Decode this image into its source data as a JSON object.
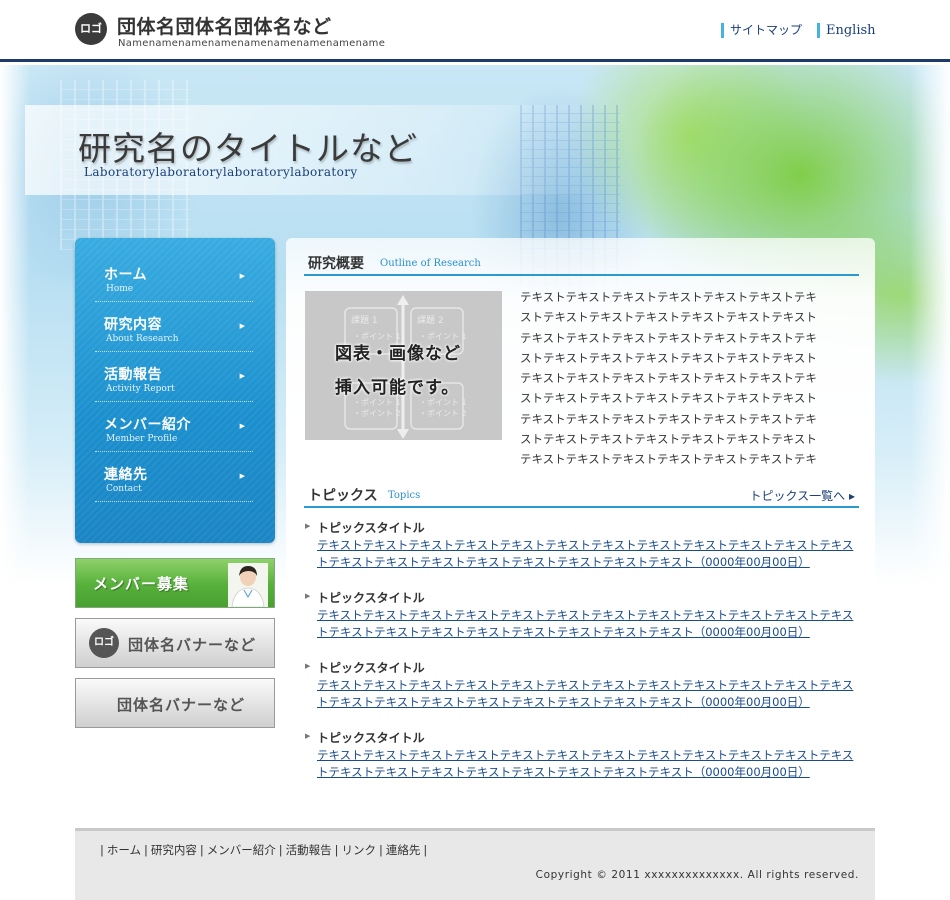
{
  "header": {
    "logo_text": "ロゴ",
    "org_name": "団体名団体名団体名など",
    "org_sub": "Namenamenamenamenamenamenamenamename",
    "links": [
      {
        "label": "サイトマップ"
      },
      {
        "label": "English"
      }
    ]
  },
  "hero": {
    "title": "研究名のタイトルなど",
    "subtitle": "Laboratorylaboratorylaboratorylaboratory"
  },
  "nav": {
    "items": [
      {
        "jp": "ホーム",
        "en": "Home"
      },
      {
        "jp": "研究内容",
        "en": "About Research"
      },
      {
        "jp": "活動報告",
        "en": "Activity Report"
      },
      {
        "jp": "メンバー紹介",
        "en": "Member Profile"
      },
      {
        "jp": "連絡先",
        "en": "Contact"
      }
    ],
    "arrow": "▶"
  },
  "banners": {
    "recruit": "メンバー募集",
    "org_logo": "ロゴ",
    "org_banner1": "団体名バナーなど",
    "org_banner2": "団体名バナーなど"
  },
  "research": {
    "heading_jp": "研究概要",
    "heading_en": "Outline of Research",
    "image": {
      "line1": "図表・画像など",
      "line2": "挿入可能です。",
      "box1_title": "課題 1",
      "box2_title": "課題 2",
      "point1": "・ポイント 1",
      "point2": "・ポイント 2"
    },
    "text": "テキストテキストテキストテキストテキストテキストテキストテキストテキストテキストテキストテキストテキストテキストテキストテキストテキストテキストテキストテキストテキストテキストテキストテキストテキストテキストテキストテキストテキストテキストテキストテキストテキストテキストテキストテキストテキストテキストテキストテキストテキストテキストテキストテキストテキストテキストテキストテキストテキストテキストテキストテキストテキストテキストテキストテキストテキストテキストテキ"
  },
  "topics": {
    "heading_jp": "トピックス",
    "heading_en": "Topics",
    "all_link": "トピックス一覧へ ▸",
    "items": [
      {
        "title": "トピックスタイトル",
        "body": "テキストテキストテキストテキストテキストテキストテキストテキストテキストテキストテキストテキストテキストテキストテキストテキストテキストテキストテキストテキスト（0000年00月00日）"
      },
      {
        "title": "トピックスタイトル",
        "body": "テキストテキストテキストテキストテキストテキストテキストテキストテキストテキストテキストテキストテキストテキストテキストテキストテキストテキストテキストテキスト（0000年00月00日）"
      },
      {
        "title": "トピックスタイトル",
        "body": "テキストテキストテキストテキストテキストテキストテキストテキストテキストテキストテキストテキストテキストテキストテキストテキストテキストテキストテキストテキスト（0000年00月00日）"
      },
      {
        "title": "トピックスタイトル",
        "body": "テキストテキストテキストテキストテキストテキストテキストテキストテキストテキストテキストテキストテキストテキストテキストテキストテキストテキストテキストテキスト（0000年00月00日）"
      }
    ],
    "bullet": "▶"
  },
  "footer": {
    "links": [
      {
        "label": "ホーム"
      },
      {
        "label": "研究内容"
      },
      {
        "label": "メンバー紹介"
      },
      {
        "label": "活動報告"
      },
      {
        "label": "リンク"
      },
      {
        "label": "連絡先"
      }
    ],
    "separator": "|",
    "copyright": "Copyright © 2011 xxxxxxxxxxxxxx. All rights reserved."
  },
  "colors": {
    "accent": "#2b98cf",
    "navy": "#1c3a6b",
    "nav_blue": "#1b8fcd",
    "link": "#1a4b8c"
  }
}
